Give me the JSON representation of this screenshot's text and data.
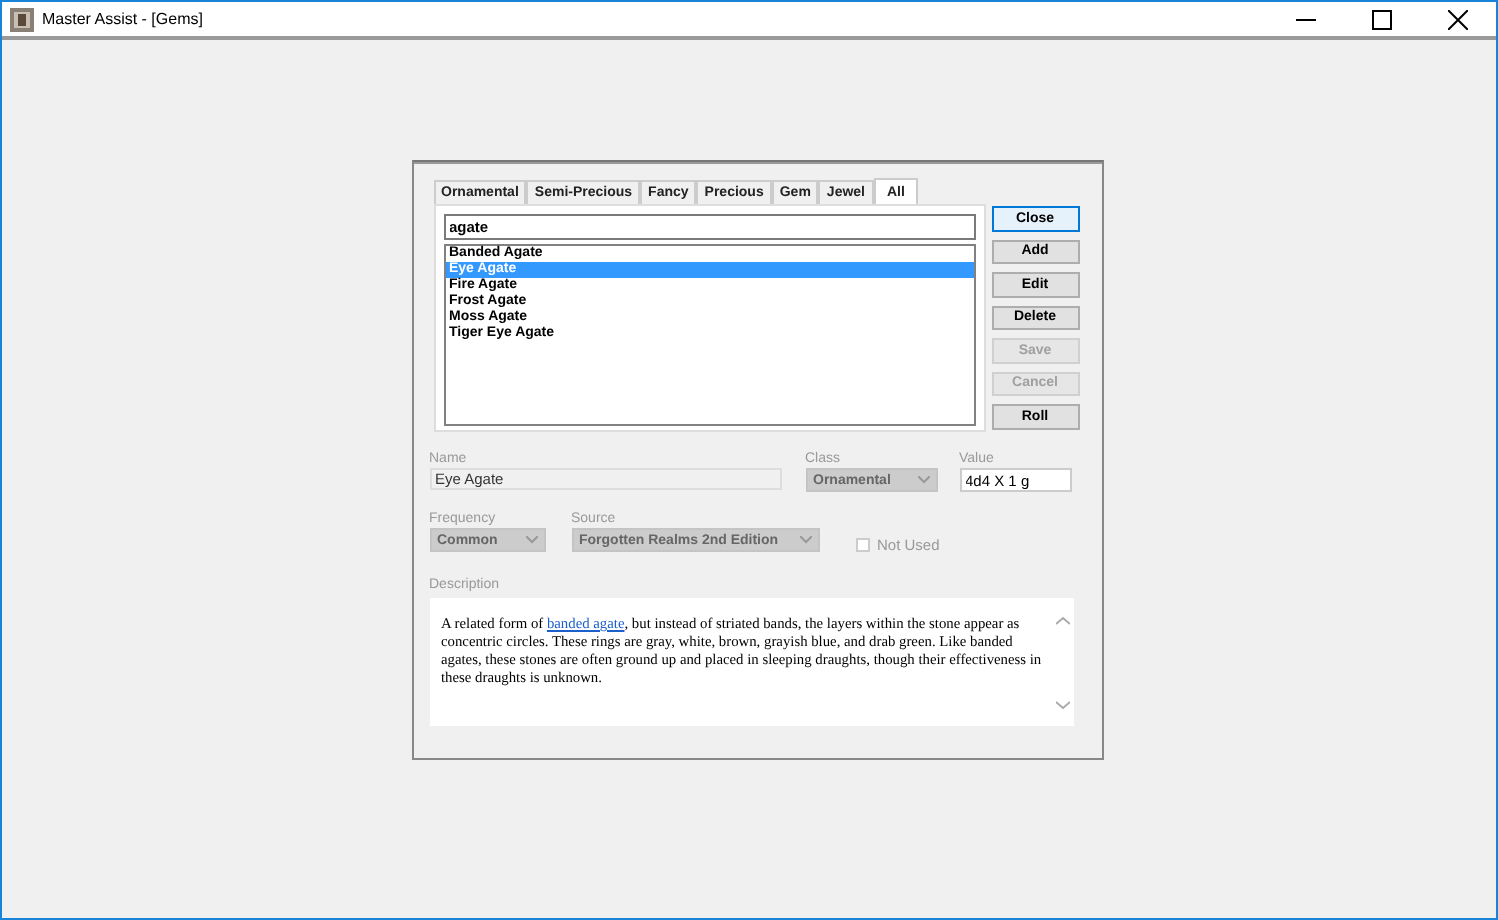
{
  "window": {
    "title": "Master Assist - [Gems]"
  },
  "tabs": [
    {
      "label": "Ornamental",
      "selected": false
    },
    {
      "label": "Semi-Precious",
      "selected": false
    },
    {
      "label": "Fancy",
      "selected": false
    },
    {
      "label": "Precious",
      "selected": false
    },
    {
      "label": "Gem",
      "selected": false
    },
    {
      "label": "Jewel",
      "selected": false
    },
    {
      "label": "All",
      "selected": true
    }
  ],
  "search": {
    "value": "agate"
  },
  "list": [
    {
      "label": "Banded Agate",
      "selected": false
    },
    {
      "label": "Eye Agate",
      "selected": true
    },
    {
      "label": "Fire Agate",
      "selected": false
    },
    {
      "label": "Frost Agate",
      "selected": false
    },
    {
      "label": "Moss Agate",
      "selected": false
    },
    {
      "label": "Tiger Eye Agate",
      "selected": false
    }
  ],
  "buttons": [
    {
      "label": "Close",
      "disabled": false,
      "default": true
    },
    {
      "label": "Add",
      "disabled": false,
      "default": false
    },
    {
      "label": "Edit",
      "disabled": false,
      "default": false
    },
    {
      "label": "Delete",
      "disabled": false,
      "default": false
    },
    {
      "label": "Save",
      "disabled": true,
      "default": false
    },
    {
      "label": "Cancel",
      "disabled": true,
      "default": false
    },
    {
      "label": "Roll",
      "disabled": false,
      "default": false
    }
  ],
  "name": {
    "label": "Name",
    "value": "Eye Agate"
  },
  "class": {
    "label": "Class",
    "value": "Ornamental"
  },
  "value": {
    "label": "Value",
    "value": "4d4 X 1 g"
  },
  "frequency": {
    "label": "Frequency",
    "value": "Common"
  },
  "source": {
    "label": "Source",
    "value": "Forgotten Realms 2nd Edition"
  },
  "not_used": {
    "label": "Not Used",
    "checked": false
  },
  "description": {
    "label": "Description",
    "before": "A related form of ",
    "link": "banded agate",
    "after": ", but instead of striated bands, the layers within the stone appear as concentric circles.  These rings are gray, white, brown, grayish blue, and drab green.  Like banded agates, these stones are often ground up and placed in sleeping draughts, though their effectiveness in these draughts is unknown."
  }
}
